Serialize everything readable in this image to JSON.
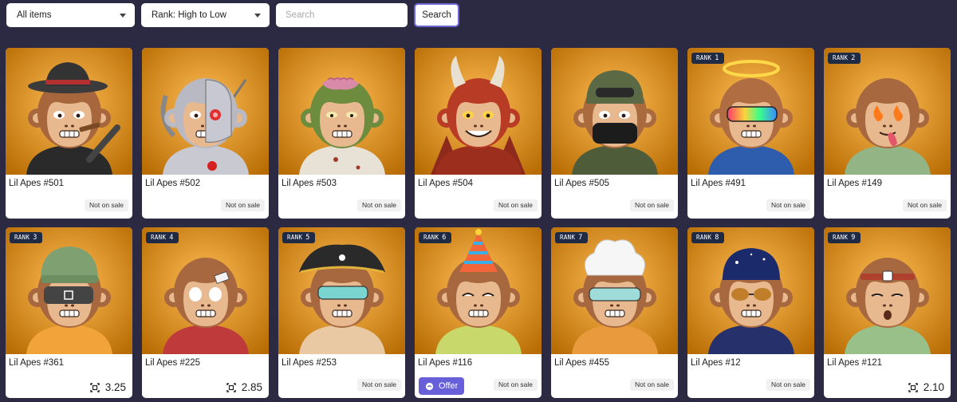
{
  "filters": {
    "category_value": "All items",
    "sort_value": "Rank: High to Low",
    "search_placeholder": "Search",
    "search_button": "Search"
  },
  "rank_prefix": "RANK",
  "items": [
    {
      "title": "Lil Apes #501",
      "rank": "",
      "status": "Not on sale",
      "price": "",
      "bg": "#e0952c",
      "fur": "#a8663c",
      "accessory": "fedora-cigar",
      "clothes": "#2a2a2a"
    },
    {
      "title": "Lil Apes #502",
      "rank": "",
      "status": "Not on sale",
      "price": "",
      "bg": "#b9444b",
      "fur": "#b9b9c3",
      "accessory": "cyborg",
      "clothes": "#c9c9d2"
    },
    {
      "title": "Lil Apes #503",
      "rank": "",
      "status": "Not on sale",
      "price": "",
      "bg": "#3c6266",
      "fur": "#6d8c3e",
      "accessory": "zombie",
      "clothes": "#e8e2d6"
    },
    {
      "title": "Lil Apes #504",
      "rank": "",
      "status": "Not on sale",
      "price": "",
      "bg": "#151515",
      "fur": "#b83b26",
      "accessory": "devil",
      "clothes": "#9c2e1e"
    },
    {
      "title": "Lil Apes #505",
      "rank": "",
      "status": "Not on sale",
      "price": "",
      "bg": "#d7d1be",
      "fur": "#a96b3e",
      "accessory": "soldier",
      "clothes": "#4f5c3a"
    },
    {
      "title": "Lil Apes #491",
      "rank": "1",
      "status": "Not on sale",
      "price": "",
      "bg": "#7eb6ec",
      "fur": "#b06d42",
      "accessory": "halo-visor",
      "clothes": "#2f5dae"
    },
    {
      "title": "Lil Apes #149",
      "rank": "2",
      "status": "Not on sale",
      "price": "",
      "bg": "#e87268",
      "fur": "#a8683f",
      "accessory": "fire-eyes",
      "clothes": "#93b585"
    },
    {
      "title": "Lil Apes #361",
      "rank": "3",
      "status": "",
      "price": "3.25",
      "bg": "#a8e0de",
      "fur": "#a8683f",
      "accessory": "beanie-vr",
      "clothes": "#f2a43a"
    },
    {
      "title": "Lil Apes #225",
      "rank": "4",
      "status": "",
      "price": "2.85",
      "bg": "#e8726b",
      "fur": "#a8683f",
      "accessory": "white-eyes",
      "clothes": "#bf3b3b"
    },
    {
      "title": "Lil Apes #253",
      "rank": "5",
      "status": "Not on sale",
      "price": "",
      "bg": "#7fb4ea",
      "fur": "#a8683f",
      "accessory": "pirate",
      "clothes": "#e8c9a4"
    },
    {
      "title": "Lil Apes #116",
      "rank": "6",
      "status": "Not on sale",
      "price": "",
      "bg": "#b9d3ee",
      "fur": "#a8683f",
      "accessory": "party-hat",
      "clothes": "#c9d86a",
      "offer": "Offer"
    },
    {
      "title": "Lil Apes #455",
      "rank": "7",
      "status": "Not on sale",
      "price": "",
      "bg": "#4a7a99",
      "fur": "#a8683f",
      "accessory": "chef",
      "clothes": "#e99a3c"
    },
    {
      "title": "Lil Apes #12",
      "rank": "8",
      "status": "Not on sale",
      "price": "",
      "bg": "#8de17e",
      "fur": "#a8683f",
      "accessory": "space-shades",
      "clothes": "#26306b"
    },
    {
      "title": "Lil Apes #121",
      "rank": "9",
      "status": "",
      "price": "2.10",
      "bg": "#e8736b",
      "fur": "#a8683f",
      "accessory": "headband",
      "clothes": "#9ac08a"
    }
  ]
}
